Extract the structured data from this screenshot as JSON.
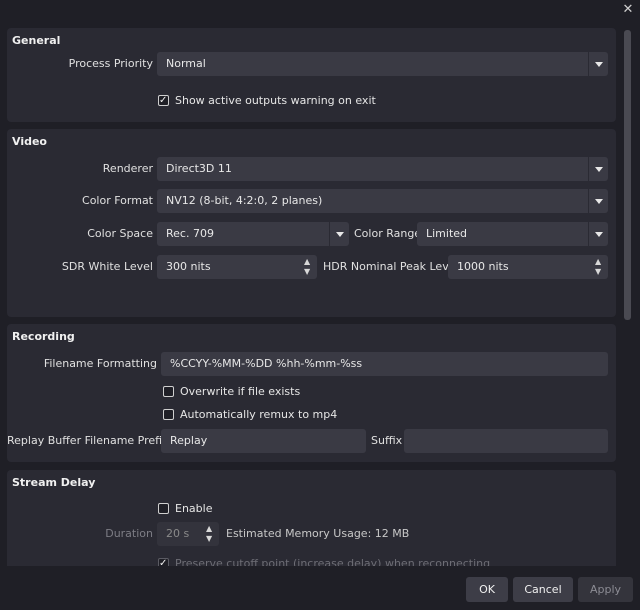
{
  "window": {
    "close_icon": "close-icon"
  },
  "general": {
    "title": "General",
    "process_priority_label": "Process Priority",
    "process_priority_value": "Normal",
    "show_active_outputs_warning": "Show active outputs warning on exit",
    "show_active_outputs_checked": true
  },
  "video": {
    "title": "Video",
    "renderer_label": "Renderer",
    "renderer_value": "Direct3D 11",
    "color_format_label": "Color Format",
    "color_format_value": "NV12 (8-bit, 4:2:0, 2 planes)",
    "color_space_label": "Color Space",
    "color_space_value": "Rec. 709",
    "color_range_label": "Color Range",
    "color_range_value": "Limited",
    "sdr_white_label": "SDR White Level",
    "sdr_white_value": "300 nits",
    "hdr_peak_label": "HDR Nominal Peak Level",
    "hdr_peak_value": "1000 nits"
  },
  "recording": {
    "title": "Recording",
    "filename_formatting_label": "Filename Formatting",
    "filename_formatting_value": "%CCYY-%MM-%DD %hh-%mm-%ss",
    "overwrite_label": "Overwrite if file exists",
    "overwrite_checked": false,
    "remux_label": "Automatically remux to mp4",
    "remux_checked": false,
    "replay_prefix_label": "Replay Buffer Filename Prefix",
    "replay_prefix_value": "Replay",
    "suffix_label": "Suffix",
    "suffix_value": ""
  },
  "stream_delay": {
    "title": "Stream Delay",
    "enable_label": "Enable",
    "enable_checked": false,
    "duration_label": "Duration",
    "duration_value": "20 s",
    "memory_usage_label": "Estimated Memory Usage: 12 MB",
    "preserve_label": "Preserve cutoff point (increase delay) when reconnecting",
    "preserve_checked": true
  },
  "buttons": {
    "ok": "OK",
    "cancel": "Cancel",
    "apply": "Apply"
  },
  "colors": {
    "background": "#1f1f26",
    "group": "#2a2a33",
    "field": "#3a3a44"
  }
}
